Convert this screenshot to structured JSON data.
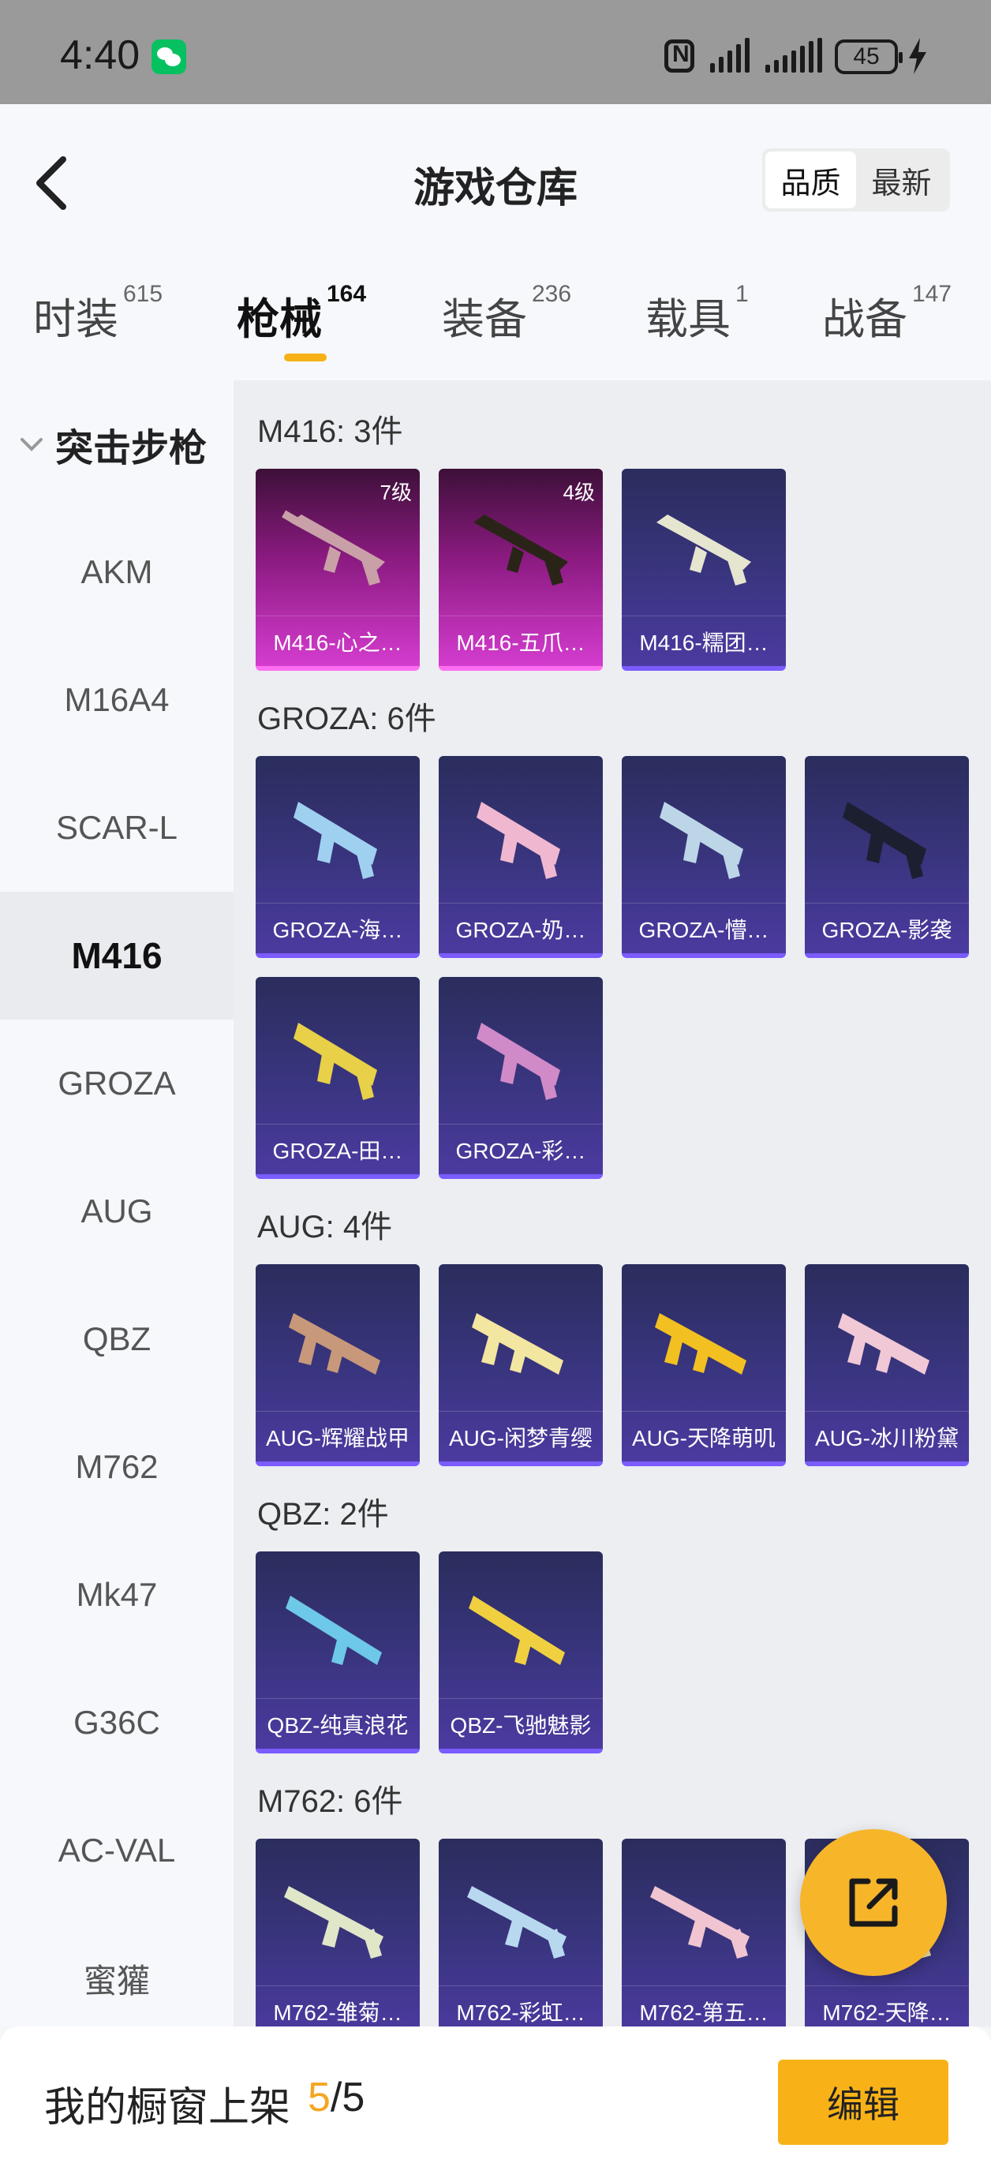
{
  "status_bar": {
    "time": "4:40",
    "battery": "45"
  },
  "header": {
    "title": "游戏仓库",
    "sort_options": [
      "品质",
      "最新"
    ],
    "tabs": [
      {
        "label": "时装",
        "count": "615"
      },
      {
        "label": "枪械",
        "count": "164"
      },
      {
        "label": "装备",
        "count": "236"
      },
      {
        "label": "载具",
        "count": "1"
      },
      {
        "label": "战备",
        "count": "147"
      }
    ]
  },
  "sidebar": {
    "group": "突击步枪",
    "items": [
      "AKM",
      "M16A4",
      "SCAR-L",
      "M416",
      "GROZA",
      "AUG",
      "QBZ",
      "M762",
      "Mk47",
      "G36C",
      "AC-VAL",
      "蜜獾"
    ]
  },
  "sections": [
    {
      "title": "M416: 3件",
      "items": [
        {
          "name": "M416-心之…",
          "grade": "7级"
        },
        {
          "name": "M416-五爪…",
          "grade": "4级"
        },
        {
          "name": "M416-糯团…"
        }
      ]
    },
    {
      "title": "GROZA: 6件",
      "items": [
        {
          "name": "GROZA-海…"
        },
        {
          "name": "GROZA-奶…"
        },
        {
          "name": "GROZA-懵…"
        },
        {
          "name": "GROZA-影袭"
        },
        {
          "name": "GROZA-田…"
        },
        {
          "name": "GROZA-彩…"
        }
      ]
    },
    {
      "title": "AUG: 4件",
      "items": [
        {
          "name": "AUG-辉耀战甲"
        },
        {
          "name": "AUG-闲梦青缨"
        },
        {
          "name": "AUG-天降萌叽"
        },
        {
          "name": "AUG-冰川粉黛"
        }
      ]
    },
    {
      "title": "QBZ: 2件",
      "items": [
        {
          "name": "QBZ-纯真浪花"
        },
        {
          "name": "QBZ-飞驰魅影"
        }
      ]
    },
    {
      "title": "M762: 6件",
      "items": [
        {
          "name": "M762-雏菊…"
        },
        {
          "name": "M762-彩虹…"
        },
        {
          "name": "M762-第五…"
        },
        {
          "name": "M762-天降…"
        }
      ]
    }
  ],
  "bottom_bar": {
    "label": "我的橱窗上架",
    "current": "5",
    "separator": "/",
    "total": "5",
    "edit_label": "编辑"
  },
  "colors": {
    "accent": "#f5b115",
    "card_purple": "#3a3580",
    "card_pink": "#d43ccf",
    "edit_button": "#f8b218"
  }
}
